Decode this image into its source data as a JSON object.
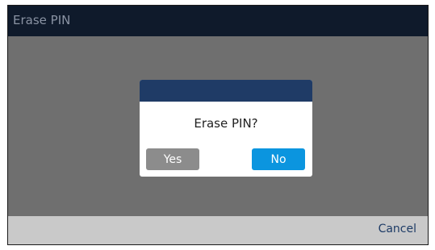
{
  "header": {
    "title": "Erase PIN"
  },
  "dialog": {
    "message": "Erase PIN?",
    "yes_label": "Yes",
    "no_label": "No"
  },
  "softkeys": {
    "cancel_label": "Cancel"
  },
  "colors": {
    "title_bar": "#0f1a2b",
    "dialog_header": "#1f3b66",
    "no_button": "#0b95df",
    "yes_button": "#8c8c8c",
    "softkey_bar": "#c9c9c9"
  }
}
